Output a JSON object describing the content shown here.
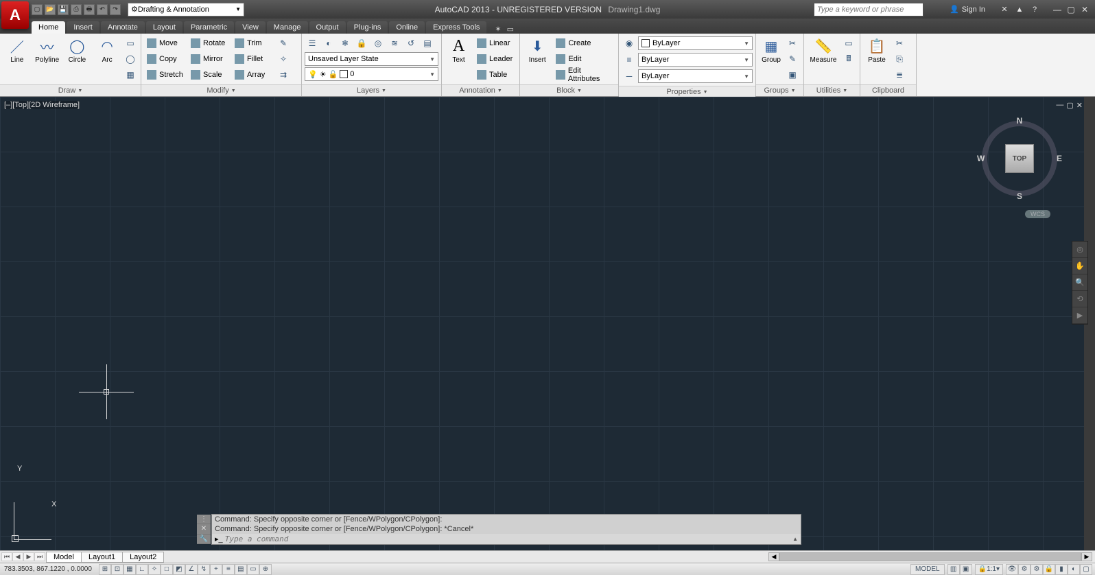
{
  "title": {
    "app": "AutoCAD 2013 - UNREGISTERED VERSION",
    "file": "Drawing1.dwg"
  },
  "workspace": "Drafting & Annotation",
  "search_placeholder": "Type a keyword or phrase",
  "signin": "Sign In",
  "tabs": [
    "Home",
    "Insert",
    "Annotate",
    "Layout",
    "Parametric",
    "View",
    "Manage",
    "Output",
    "Plug-ins",
    "Online",
    "Express Tools"
  ],
  "active_tab": "Home",
  "ribbon": {
    "draw": {
      "title": "Draw",
      "items": [
        "Line",
        "Polyline",
        "Circle",
        "Arc"
      ]
    },
    "modify": {
      "title": "Modify",
      "items": [
        "Move",
        "Rotate",
        "Trim",
        "Copy",
        "Mirror",
        "Fillet",
        "Stretch",
        "Scale",
        "Array"
      ]
    },
    "layers": {
      "title": "Layers",
      "state": "Unsaved Layer State",
      "current": "0"
    },
    "annotation": {
      "title": "Annotation",
      "text": "Text",
      "linear": "Linear",
      "leader": "Leader",
      "table": "Table"
    },
    "block": {
      "title": "Block",
      "insert": "Insert",
      "create": "Create",
      "edit": "Edit",
      "editattr": "Edit Attributes"
    },
    "properties": {
      "title": "Properties",
      "color": "ByLayer",
      "ltype": "ByLayer",
      "lweight": "ByLayer"
    },
    "groups": {
      "title": "Groups",
      "group": "Group"
    },
    "utilities": {
      "title": "Utilities",
      "measure": "Measure"
    },
    "clipboard": {
      "title": "Clipboard",
      "paste": "Paste"
    }
  },
  "viewport_label": "[–][Top][2D Wireframe]",
  "viewcube": {
    "face": "TOP",
    "n": "N",
    "s": "S",
    "e": "E",
    "w": "W",
    "wcs": "WCS"
  },
  "ucs": {
    "x": "X",
    "y": "Y"
  },
  "command": {
    "hist1": "Command: Specify opposite corner or [Fence/WPolygon/CPolygon]:",
    "hist2": "Command: Specify opposite corner or [Fence/WPolygon/CPolygon]: *Cancel*",
    "placeholder": "Type a command"
  },
  "layout_tabs": [
    "Model",
    "Layout1",
    "Layout2"
  ],
  "status": {
    "coords": "783.3503, 867.1220 , 0.0000",
    "model": "MODEL",
    "scale": "1:1"
  }
}
